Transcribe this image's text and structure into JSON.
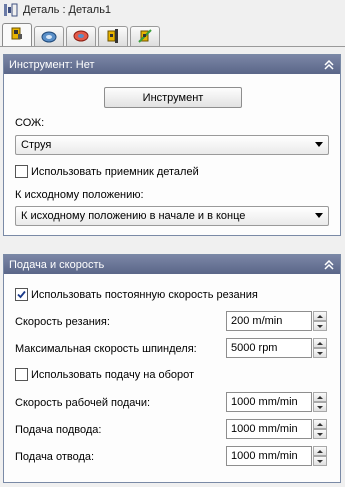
{
  "title": "Деталь : Деталь1",
  "tabs": [
    {
      "icon": "part-setup-icon",
      "active": true
    },
    {
      "icon": "tool-geometry-icon",
      "active": false
    },
    {
      "icon": "tool-holder-icon",
      "active": false
    },
    {
      "icon": "feed-speed-icon",
      "active": false
    },
    {
      "icon": "program-end-icon",
      "active": false
    }
  ],
  "tool_panel": {
    "header": "Инструмент: Нет",
    "tool_button": "Инструмент",
    "coolant_label": "СОЖ:",
    "coolant_value": "Струя",
    "use_catcher_label": "Использовать приемник деталей",
    "use_catcher_checked": false,
    "home_label": "К исходному положению:",
    "home_value": "К исходному положению в начале и в конце"
  },
  "feed_panel": {
    "header": "Подача и скорость",
    "constant_speed_label": "Использовать постоянную скорость резания",
    "constant_speed_checked": true,
    "cutting_speed_label": "Скорость резания:",
    "cutting_speed_value": "200 m/min",
    "max_spindle_label": "Максимальная скорость шпинделя:",
    "max_spindle_value": "5000 rpm",
    "feed_per_rev_label": "Использовать подачу на оборот",
    "feed_per_rev_checked": false,
    "work_feed_label": "Скорость рабочей подачи:",
    "work_feed_value": "1000 mm/min",
    "lead_in_label": "Подача подвода:",
    "lead_in_value": "1000 mm/min",
    "lead_out_label": "Подача отвода:",
    "lead_out_value": "1000 mm/min"
  },
  "colors": {
    "panel_header": "#6b7596",
    "panel_border": "#7a8aa6",
    "background": "#f0f0f0"
  }
}
